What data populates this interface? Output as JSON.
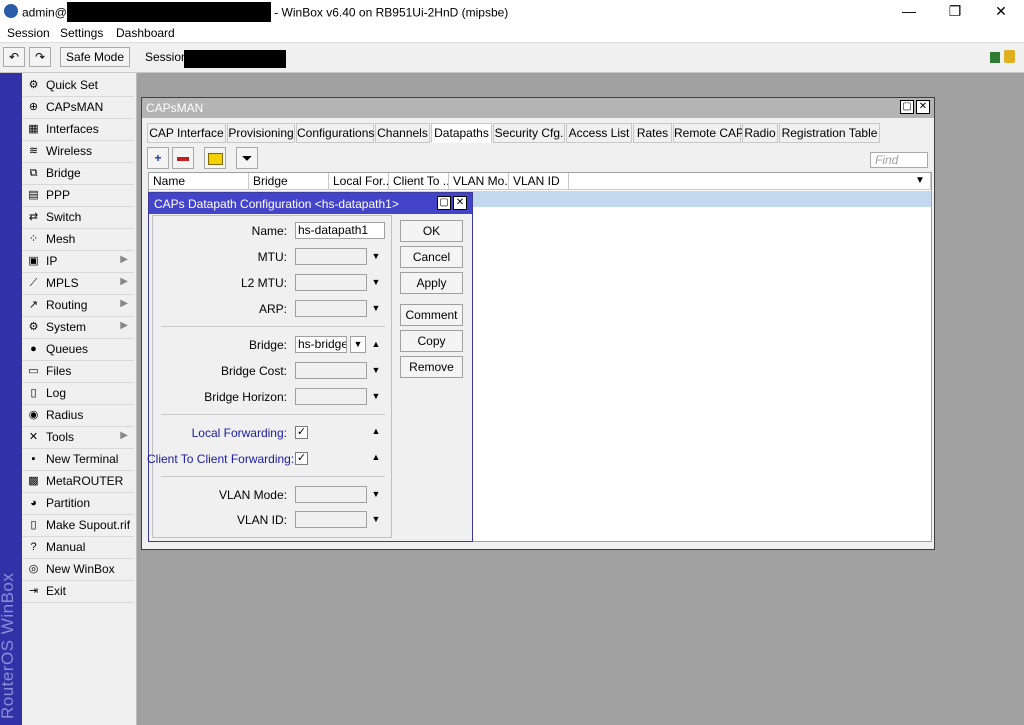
{
  "window": {
    "user": "admin@",
    "title": "- WinBox v6.40 on RB951Ui-2HnD (mipsbe)",
    "minimize": "—",
    "maximize": "❐",
    "close": "✕"
  },
  "menu": [
    "Session",
    "Settings",
    "Dashboard"
  ],
  "toolbar": {
    "undo": "↶",
    "redo": "↷",
    "safe_mode": "Safe Mode",
    "session_label": "Session:"
  },
  "sidebar": {
    "brand": "RouterOS WinBox",
    "items": [
      {
        "label": "Quick Set",
        "icon": "⚙",
        "submenu": false
      },
      {
        "label": "CAPsMAN",
        "icon": "⊕",
        "submenu": false
      },
      {
        "label": "Interfaces",
        "icon": "▦",
        "submenu": false
      },
      {
        "label": "Wireless",
        "icon": "≋",
        "submenu": false
      },
      {
        "label": "Bridge",
        "icon": "⧉",
        "submenu": false
      },
      {
        "label": "PPP",
        "icon": "▤",
        "submenu": false
      },
      {
        "label": "Switch",
        "icon": "⇄",
        "submenu": false
      },
      {
        "label": "Mesh",
        "icon": "⁘",
        "submenu": false
      },
      {
        "label": "IP",
        "icon": "▣",
        "submenu": true
      },
      {
        "label": "MPLS",
        "icon": "⟋",
        "submenu": true
      },
      {
        "label": "Routing",
        "icon": "↗",
        "submenu": true
      },
      {
        "label": "System",
        "icon": "⚙",
        "submenu": true
      },
      {
        "label": "Queues",
        "icon": "●",
        "submenu": false
      },
      {
        "label": "Files",
        "icon": "▭",
        "submenu": false
      },
      {
        "label": "Log",
        "icon": "▯",
        "submenu": false
      },
      {
        "label": "Radius",
        "icon": "◉",
        "submenu": false
      },
      {
        "label": "Tools",
        "icon": "✕",
        "submenu": true
      },
      {
        "label": "New Terminal",
        "icon": "▪",
        "submenu": false
      },
      {
        "label": "MetaROUTER",
        "icon": "▩",
        "submenu": false
      },
      {
        "label": "Partition",
        "icon": "◕",
        "submenu": false
      },
      {
        "label": "Make Supout.rif",
        "icon": "▯",
        "submenu": false
      },
      {
        "label": "Manual",
        "icon": "?",
        "submenu": false
      },
      {
        "label": "New WinBox",
        "icon": "◎",
        "submenu": false
      },
      {
        "label": "Exit",
        "icon": "⇥",
        "submenu": false
      }
    ]
  },
  "capsman": {
    "title": "CAPsMAN",
    "tabs": [
      "CAP Interface",
      "Provisioning",
      "Configurations",
      "Channels",
      "Datapaths",
      "Security Cfg.",
      "Access List",
      "Rates",
      "Remote CAP",
      "Radio",
      "Registration Table"
    ],
    "active_tab": "Datapaths",
    "find_placeholder": "Find",
    "columns": [
      "Name",
      "Bridge",
      "Local For...",
      "Client To ...",
      "VLAN Mo...",
      "VLAN ID"
    ]
  },
  "dialog": {
    "title": "CAPs Datapath Configuration <hs-datapath1>",
    "fields": {
      "name_label": "Name:",
      "name_value": "hs-datapath1",
      "mtu_label": "MTU:",
      "l2mtu_label": "L2 MTU:",
      "arp_label": "ARP:",
      "bridge_label": "Bridge:",
      "bridge_value": "hs-bridge",
      "bridge_cost_label": "Bridge Cost:",
      "bridge_horizon_label": "Bridge Horizon:",
      "local_fwd_label": "Local Forwarding:",
      "client_fwd_label": "Client To Client Forwarding:",
      "vlan_mode_label": "VLAN Mode:",
      "vlan_id_label": "VLAN ID:"
    },
    "buttons": {
      "ok": "OK",
      "cancel": "Cancel",
      "apply": "Apply",
      "comment": "Comment",
      "copy": "Copy",
      "remove": "Remove"
    }
  },
  "colors": {
    "sidebar_strip": "#3232a8",
    "dialog_title": "#4444c8",
    "selected_row": "#c3d7ef",
    "desktop": "#a0a0a0"
  }
}
